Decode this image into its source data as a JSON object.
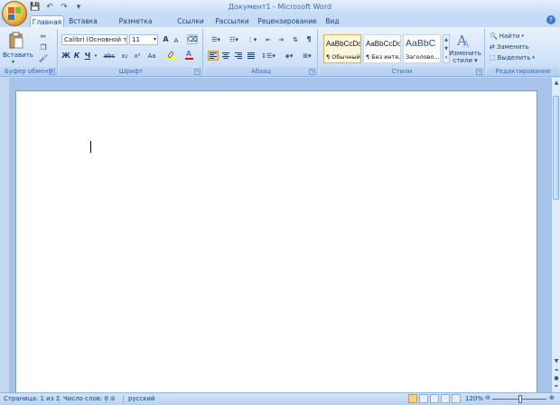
{
  "window": {
    "title": "Документ1 - Microsoft Word"
  },
  "quick_access": {
    "save": "💾",
    "undo": "↶",
    "redo": "↷",
    "customize": "▾"
  },
  "tabs": [
    {
      "label": "Главная",
      "active": true
    },
    {
      "label": "Вставка"
    },
    {
      "label": "Разметка страницы"
    },
    {
      "label": "Ссылки"
    },
    {
      "label": "Рассылки"
    },
    {
      "label": "Рецензирование"
    },
    {
      "label": "Вид"
    }
  ],
  "help_icon": "?",
  "ribbon": {
    "clipboard": {
      "label": "Буфер обмена",
      "paste_label": "Вставить"
    },
    "font": {
      "label": "Шрифт",
      "font_name": "Calibri (Основной те",
      "font_size": "11",
      "bold": "Ж",
      "italic": "К",
      "underline": "Ч",
      "strike": "abc",
      "subscript": "x₂",
      "superscript": "x²",
      "case": "Aa",
      "grow": "A",
      "shrink": "A"
    },
    "paragraph": {
      "label": "Абзац",
      "pilcrow": "¶"
    },
    "styles": {
      "label": "Стили",
      "items": [
        {
          "sample": "AaBbCcDc",
          "name": "¶ Обычный",
          "selected": true
        },
        {
          "sample": "AaBbCcDc",
          "name": "¶ Без инте..."
        },
        {
          "sample": "AaBbC",
          "name": "Заголово..."
        }
      ],
      "change_label_1": "Изменить",
      "change_label_2": "стили"
    },
    "editing": {
      "label": "Редактирование",
      "find": "Найти",
      "replace": "Заменить",
      "select": "Выделить"
    }
  },
  "status": {
    "page": "Страница: 1 из 1",
    "words": "Число слов: 0",
    "language": "русский",
    "zoom": "120%"
  },
  "colors": {
    "accent": "#15428b",
    "highlight": "#ffff00",
    "font_color": "#ff0000"
  }
}
